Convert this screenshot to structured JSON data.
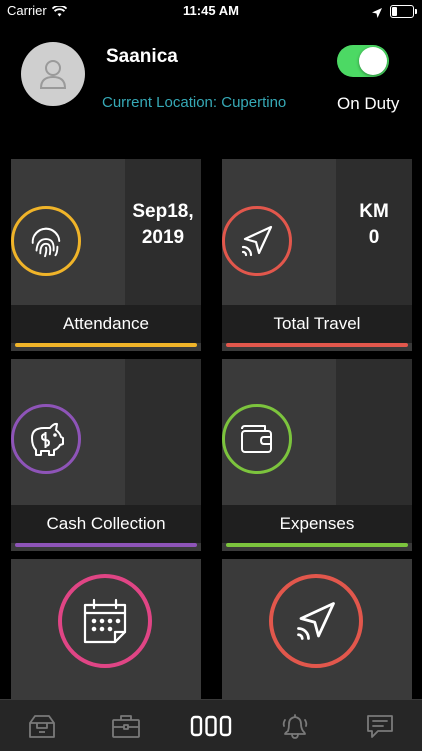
{
  "status": {
    "carrier": "Carrier",
    "time": "11:45 AM"
  },
  "profile": {
    "name": "Saanica",
    "location": "Current Location: Cupertino",
    "duty_label": "On Duty",
    "on_duty": true
  },
  "cards": [
    {
      "label": "Attendance",
      "value": "Sep18,\n2019",
      "color": "#f0b429",
      "icon": "fingerprint-icon"
    },
    {
      "label": "Total Travel",
      "value": "KM\n0",
      "color": "#e2574c",
      "icon": "navigation-arrow-icon"
    },
    {
      "label": "Cash Collection",
      "value": "",
      "color": "#8e54b8",
      "icon": "piggy-bank-icon"
    },
    {
      "label": "Expenses",
      "value": "",
      "color": "#7cc43d",
      "icon": "wallet-icon"
    },
    {
      "label": "",
      "value": "",
      "color": "#e04585",
      "icon": "calendar-icon"
    },
    {
      "label": "",
      "value": "",
      "color": "#e2574c",
      "icon": "navigation-arrow-icon"
    }
  ],
  "tabs": [
    {
      "icon": "archive-box-icon",
      "active": false
    },
    {
      "icon": "briefcase-icon",
      "active": false
    },
    {
      "icon": "dashboard-icon",
      "active": true
    },
    {
      "icon": "bell-icon",
      "active": false
    },
    {
      "icon": "chat-icon",
      "active": false
    }
  ]
}
